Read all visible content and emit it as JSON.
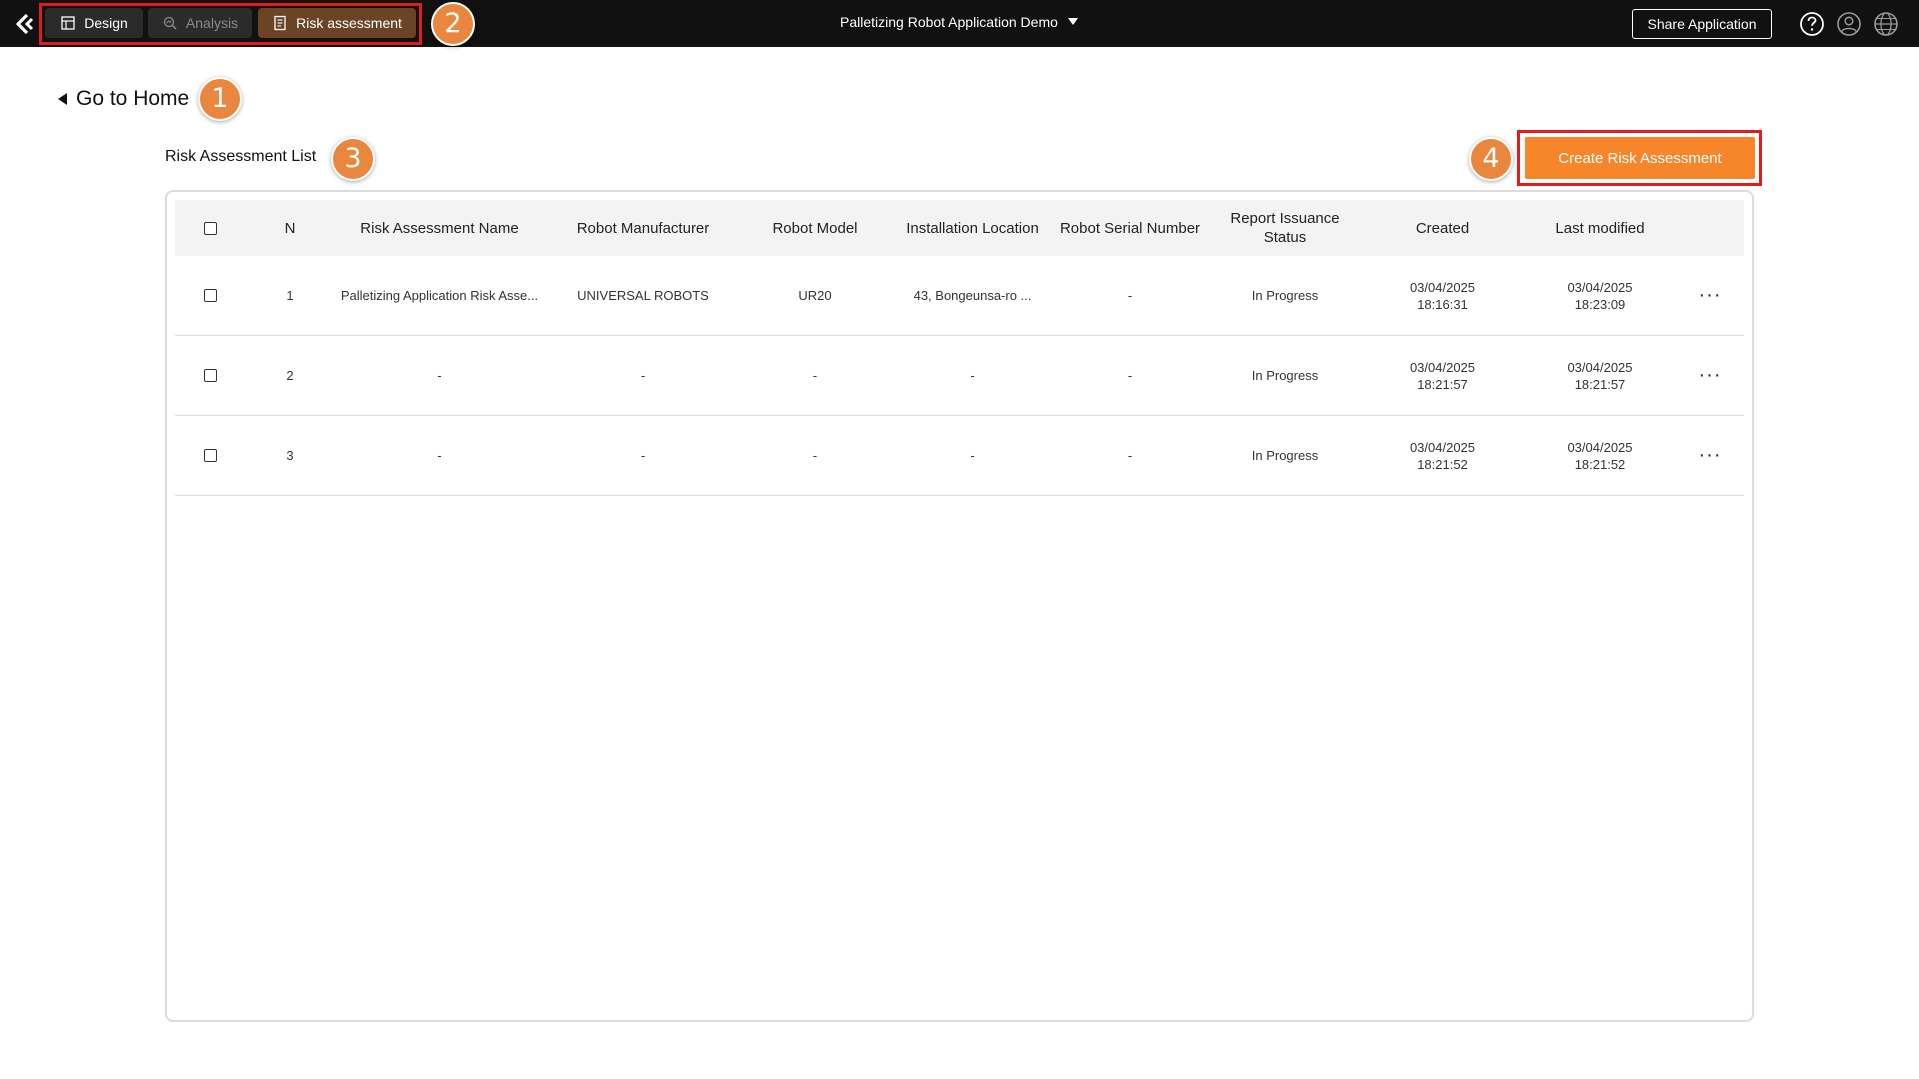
{
  "topbar": {
    "tabs": [
      {
        "label": "Design",
        "icon": "layout-icon"
      },
      {
        "label": "Analysis",
        "icon": "analysis-icon"
      },
      {
        "label": "Risk assessment",
        "icon": "document-icon"
      }
    ],
    "app_title": "Palletizing Robot Application Demo",
    "share_label": "Share Application",
    "icons": [
      "help-icon",
      "user-icon",
      "globe-icon"
    ]
  },
  "callouts": [
    "1",
    "2",
    "3",
    "4"
  ],
  "nav": {
    "go_home_label": "Go to Home"
  },
  "list": {
    "title": "Risk Assessment List",
    "create_label": "Create Risk Assessment",
    "columns": [
      "N",
      "Risk Assessment Name",
      "Robot Manufacturer",
      "Robot Model",
      "Installation Location",
      "Robot Serial Number",
      "Report Issuance Status",
      "Created",
      "Last modified"
    ],
    "rows": [
      {
        "n": "1",
        "name": "Palletizing Application Risk Asse...",
        "manufacturer": "UNIVERSAL ROBOTS",
        "model": "UR20",
        "location": "43, Bongeunsa-ro ...",
        "serial": "-",
        "status": "In Progress",
        "created_date": "03/04/2025",
        "created_time": "18:16:31",
        "modified_date": "03/04/2025",
        "modified_time": "18:23:09"
      },
      {
        "n": "2",
        "name": "-",
        "manufacturer": "-",
        "model": "-",
        "location": "-",
        "serial": "-",
        "status": "In Progress",
        "created_date": "03/04/2025",
        "created_time": "18:21:57",
        "modified_date": "03/04/2025",
        "modified_time": "18:21:57"
      },
      {
        "n": "3",
        "name": "-",
        "manufacturer": "-",
        "model": "-",
        "location": "-",
        "serial": "-",
        "status": "In Progress",
        "created_date": "03/04/2025",
        "created_time": "18:21:52",
        "modified_date": "03/04/2025",
        "modified_time": "18:21:52"
      }
    ],
    "more_label": "···"
  },
  "colors": {
    "topbar_bg": "#111111",
    "accent_orange": "#f7862a",
    "callout_orange": "#e8873d",
    "highlight_red": "#e01c1c",
    "active_tab_bg": "#6b4426"
  }
}
